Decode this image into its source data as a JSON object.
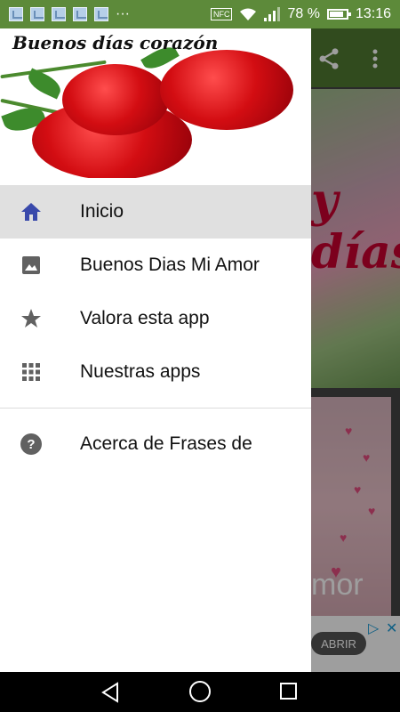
{
  "status_bar": {
    "notification_icons": [
      "image-notification-icon",
      "image-notification-icon",
      "image-notification-icon",
      "image-notification-icon",
      "image-notification-icon"
    ],
    "more_indicator": "···",
    "nfc_label": "NFC",
    "battery_percent": "78 %",
    "time": "13:16",
    "bg_color": "#5d8a3a"
  },
  "drawer": {
    "header_title": "Buenos días corazón",
    "items": [
      {
        "label": "Inicio",
        "icon": "home-icon",
        "active": true
      },
      {
        "label": "Buenos Dias Mi Amor",
        "icon": "image-icon",
        "active": false
      },
      {
        "label": "Valora esta app",
        "icon": "star-icon",
        "active": false
      },
      {
        "label": "Nuestras apps",
        "icon": "apps-grid-icon",
        "active": false
      }
    ],
    "secondary_items": [
      {
        "label": "Acerca de Frases de",
        "icon": "help-icon"
      }
    ],
    "accent_color": "#3949ab"
  },
  "background_app": {
    "toolbar_color": "#4f7a31",
    "card1_text": "y\ndías",
    "card2_text": "mor",
    "ad_button_label": "ABRIR"
  }
}
